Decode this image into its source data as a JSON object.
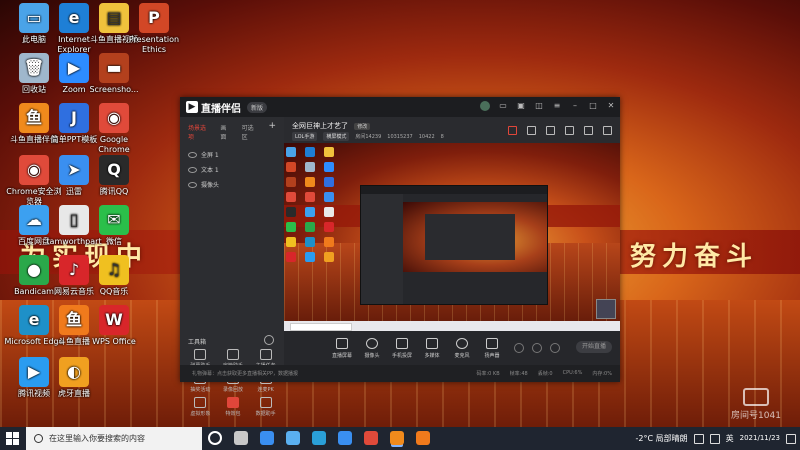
{
  "wallpaper": {
    "slogan_left": "为实现中",
    "slogan_right": "努力奋斗"
  },
  "desktop_icons": [
    {
      "label": "此电脑",
      "color": "#4aa3e8",
      "glyph": "▭",
      "icon": "computer-icon"
    },
    {
      "label": "Internet Explorer",
      "color": "#1e7fd6",
      "glyph": "e",
      "icon": "internet-explorer-icon"
    },
    {
      "label": "斗鱼直播视频",
      "color": "#f0c23c",
      "glyph": "▤",
      "icon": "folder-icon"
    },
    {
      "label": "Presentation Ethics",
      "color": "#d24726",
      "glyph": "P",
      "icon": "powerpoint-file-icon"
    },
    {
      "label": "回收站",
      "color": "#9fb7cc",
      "glyph": "🗑",
      "icon": "recycle-bin-icon"
    },
    {
      "label": "Zoom",
      "color": "#2d8cff",
      "glyph": "▶",
      "icon": "zoom-icon"
    },
    {
      "label": "Screensho...",
      "color": "#b3401d",
      "glyph": "▬",
      "icon": "image-file-icon"
    },
    {
      "label": "斗鱼直播伴侣",
      "color": "#f08a1c",
      "glyph": "鱼",
      "icon": "douyu-icon"
    },
    {
      "label": "简单PPT模板",
      "color": "#2f6fe0",
      "glyph": "J",
      "icon": "ppt-template-icon"
    },
    {
      "label": "Google Chrome",
      "color": "#e04a3a",
      "glyph": "◉",
      "icon": "chrome-icon"
    },
    {
      "label": "Chrome安全浏览器",
      "color": "#e04a3a",
      "glyph": "◉",
      "icon": "chrome-icon"
    },
    {
      "label": "迅雷",
      "color": "#3a8ff0",
      "glyph": "➤",
      "icon": "xunlei-icon"
    },
    {
      "label": "腾讯QQ",
      "color": "#2a2a2a",
      "glyph": "Q",
      "icon": "qq-icon"
    },
    {
      "label": "百度网盘",
      "color": "#3ca0f0",
      "glyph": "☁",
      "icon": "baidu-netdisk-icon"
    },
    {
      "label": "tamworthpart",
      "color": "#e8e8e8",
      "glyph": "▯",
      "icon": "text-file-icon"
    },
    {
      "label": "微信",
      "color": "#2bbf4a",
      "glyph": "✉",
      "icon": "wechat-icon"
    },
    {
      "label": "Bandicam",
      "color": "#2aa84a",
      "glyph": "●",
      "icon": "recorder-icon"
    },
    {
      "label": "网易云音乐",
      "color": "#d8262a",
      "glyph": "♪",
      "icon": "music-icon"
    },
    {
      "label": "QQ音乐",
      "color": "#f0c020",
      "glyph": "♫",
      "icon": "qq-music-icon"
    },
    {
      "label": "Microsoft Edge",
      "color": "#1e90c8",
      "glyph": "e",
      "icon": "edge-icon"
    },
    {
      "label": "斗鱼直播",
      "color": "#f07a1c",
      "glyph": "鱼",
      "icon": "douyu-live-icon"
    },
    {
      "label": "WPS Office",
      "color": "#d8262a",
      "glyph": "W",
      "icon": "wps-icon"
    },
    {
      "label": "腾讯视频",
      "color": "#2a9cf0",
      "glyph": "▶",
      "icon": "tencent-video-icon"
    },
    {
      "label": "虎牙直播",
      "color": "#f0a020",
      "glyph": "◐",
      "icon": "huya-icon"
    }
  ],
  "app": {
    "logo_text": "直播伴侣",
    "version": "新版",
    "sidebar_tabs": [
      "场景选项",
      "画面",
      "可选区"
    ],
    "scenes": [
      "全屏 1",
      "文本 1",
      "摄像头"
    ],
    "tools_header": "工具箱",
    "tools": [
      {
        "label": "弹幕助手",
        "hot": false
      },
      {
        "label": "房管助手",
        "hot": false
      },
      {
        "label": "主播任务",
        "hot": false
      },
      {
        "label": "抽奖活动",
        "hot": false
      },
      {
        "label": "录像回放",
        "hot": false
      },
      {
        "label": "连麦PK",
        "hot": false
      },
      {
        "label": "虚拟形象",
        "hot": false
      },
      {
        "label": "特效包",
        "hot": true
      },
      {
        "label": "数据助手",
        "hot": false
      }
    ],
    "room_title": "全网巨神上才艺了",
    "room_tag": "修改",
    "room_meta": {
      "category": "LOL手游",
      "mode": "横屏模式",
      "room_id": "房间14239",
      "id2": "10315237",
      "viewers": "10422",
      "fans": "8"
    },
    "controls": [
      "直播屏幕",
      "摄像头",
      "手机投屏",
      "多媒体",
      "麦克风",
      "扬声器"
    ],
    "start_button": "开始直播",
    "status_tip": "礼物弹幕：点击获取更多直播相关PP，数据播报",
    "stats": [
      "码率:0 KB",
      "帧率:48",
      "丢帧:0",
      "CPU:6%",
      "内存:0%"
    ]
  },
  "taskbar": {
    "search_placeholder": "在这里输入你要搜索的内容",
    "weather": "-2°C 局部晴朗",
    "time": "",
    "date": "2021/11/23",
    "language": "英",
    "apps": [
      {
        "name": "cortana-icon",
        "color": "#ffffff"
      },
      {
        "name": "task-view-icon",
        "color": "#c8c8c8"
      },
      {
        "name": "mail-icon",
        "color": "#3a8ff0"
      },
      {
        "name": "store-icon",
        "color": "#5ab0f0"
      },
      {
        "name": "edge-icon",
        "color": "#2aa0d8"
      },
      {
        "name": "xunlei-icon",
        "color": "#3a8ff0"
      },
      {
        "name": "chrome-icon",
        "color": "#e04a3a"
      },
      {
        "name": "douyu-icon",
        "color": "#f08a1c"
      },
      {
        "name": "douyu-live-icon",
        "color": "#f07a1c"
      }
    ]
  },
  "watermark": {
    "text": "房间号1041"
  },
  "colors": {
    "accent": "#e0463a",
    "app_bg": "#26272b",
    "taskbar_bg": "#1f2530"
  }
}
